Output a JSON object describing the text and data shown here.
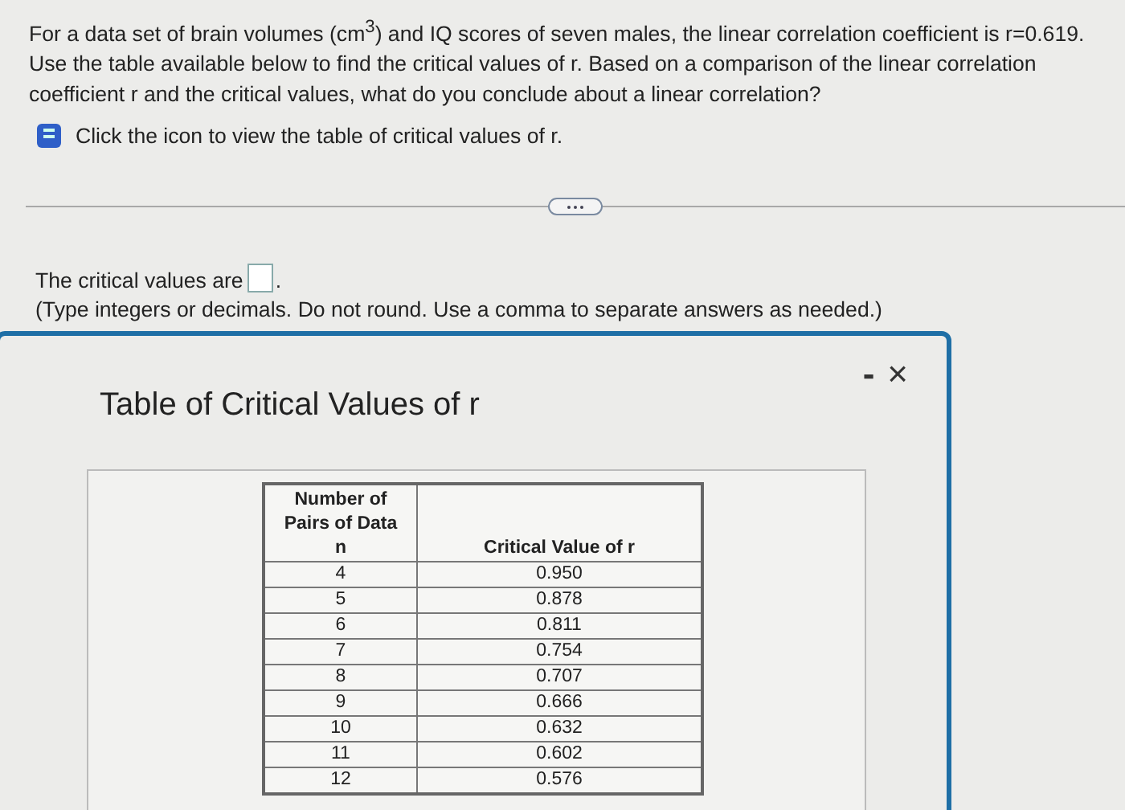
{
  "question": {
    "text": "For a data set of brain volumes (cm$^{3}$) and IQ scores of seven males, the linear correlation coefficient is r=0.619. Use the table available below to find the critical values of r. Based on a comparison of the linear correlation coefficient r and the critical values, what do you conclude about a linear correlation?",
    "hint": "Click the icon to view the table of critical values of r."
  },
  "answer": {
    "prompt": "The critical values are",
    "suffix": ".",
    "note": "(Type integers or decimals. Do not round. Use a comma to separate answers as needed.)"
  },
  "dialog": {
    "title": "Table of Critical Values of r",
    "minimize": "-",
    "close": "×",
    "table": {
      "columns": [
        "Number of Pairs of Data n",
        "Critical Value of r"
      ],
      "rows": [
        [
          "4",
          "0.950"
        ],
        [
          "5",
          "0.878"
        ],
        [
          "6",
          "0.811"
        ],
        [
          "7",
          "0.754"
        ],
        [
          "8",
          "0.707"
        ],
        [
          "9",
          "0.666"
        ],
        [
          "10",
          "0.632"
        ],
        [
          "11",
          "0.602"
        ],
        [
          "12",
          "0.576"
        ]
      ]
    }
  }
}
